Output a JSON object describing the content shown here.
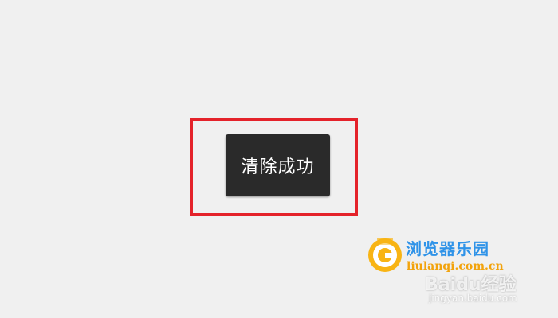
{
  "toast": {
    "message": "清除成功"
  },
  "highlight": {
    "color": "#e4222a"
  },
  "watermark": {
    "site_name": "浏览器乐园",
    "site_url": "liulanqi.com.cn",
    "brand": "Baidu经验",
    "brand_url": "jingyan.baidu.com",
    "logo_icon": "liulanqi-logo-icon",
    "title_color": "#2f93e8",
    "url_color": "#f2a30c"
  }
}
